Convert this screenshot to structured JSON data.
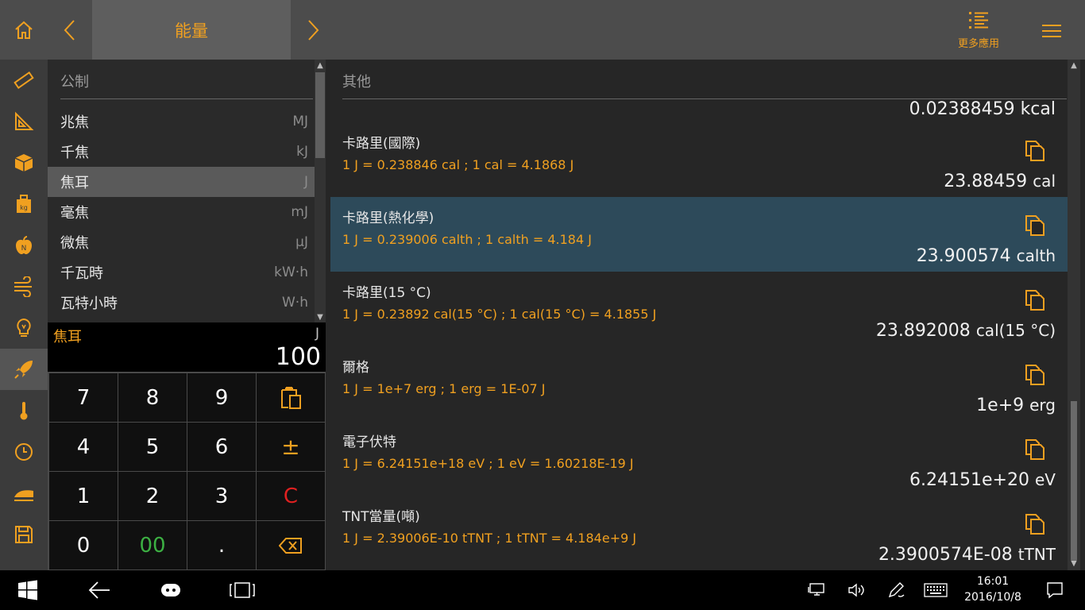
{
  "app": {
    "title": "能量",
    "more_apps_label": "更多應用"
  },
  "units": {
    "header": "公制",
    "items": [
      {
        "name": "兆焦",
        "abbr": "MJ"
      },
      {
        "name": "千焦",
        "abbr": "kJ"
      },
      {
        "name": "焦耳",
        "abbr": "J"
      },
      {
        "name": "毫焦",
        "abbr": "mJ"
      },
      {
        "name": "微焦",
        "abbr": "μJ"
      },
      {
        "name": "千瓦時",
        "abbr": "kW·h"
      },
      {
        "name": "瓦特小時",
        "abbr": "W·h"
      }
    ],
    "selected_index": 2
  },
  "input": {
    "unit_name": "焦耳",
    "unit_abbr": "J",
    "value": "100"
  },
  "keypad": {
    "keys": [
      "7",
      "8",
      "9",
      "4",
      "5",
      "6",
      "1",
      "2",
      "3",
      "0",
      "00",
      "."
    ],
    "plus_minus": "±",
    "clear": "C"
  },
  "results": {
    "header": "其他",
    "partial_top_value": "0.02388459 kcal",
    "items": [
      {
        "name": "卡路里(國際)",
        "formula": "1 J = 0.238846 cal ; 1 cal = 4.1868 J",
        "value": "23.88459",
        "unit": "cal"
      },
      {
        "name": "卡路里(熱化學)",
        "formula": "1 J = 0.239006 calth ; 1 calth = 4.184 J",
        "value": "23.900574",
        "unit": "calth"
      },
      {
        "name": "卡路里(15 °C)",
        "formula": "1 J = 0.23892 cal(15 °C) ; 1 cal(15 °C) = 4.1855 J",
        "value": "23.892008",
        "unit": "cal(15 °C)"
      },
      {
        "name": "爾格",
        "formula": "1 J = 1e+7 erg ; 1 erg = 1E-07 J",
        "value": "1e+9",
        "unit": "erg"
      },
      {
        "name": "電子伏特",
        "formula": "1 J = 6.24151e+18 eV ; 1 eV = 1.60218E-19 J",
        "value": "6.24151e+20",
        "unit": "eV"
      },
      {
        "name": "TNT當量(噸)",
        "formula": "1 J = 2.39006E-10 tTNT ; 1 tTNT = 4.184e+9 J",
        "value": "2.3900574E-08",
        "unit": "tTNT"
      }
    ],
    "selected_index": 1
  },
  "taskbar": {
    "time": "16:01",
    "date": "2016/10/8"
  },
  "colors": {
    "accent": "#f0a020",
    "selected_result_bg": "#2d4a5a",
    "clear_key": "#e02020",
    "double_zero_key": "#3cb043"
  }
}
